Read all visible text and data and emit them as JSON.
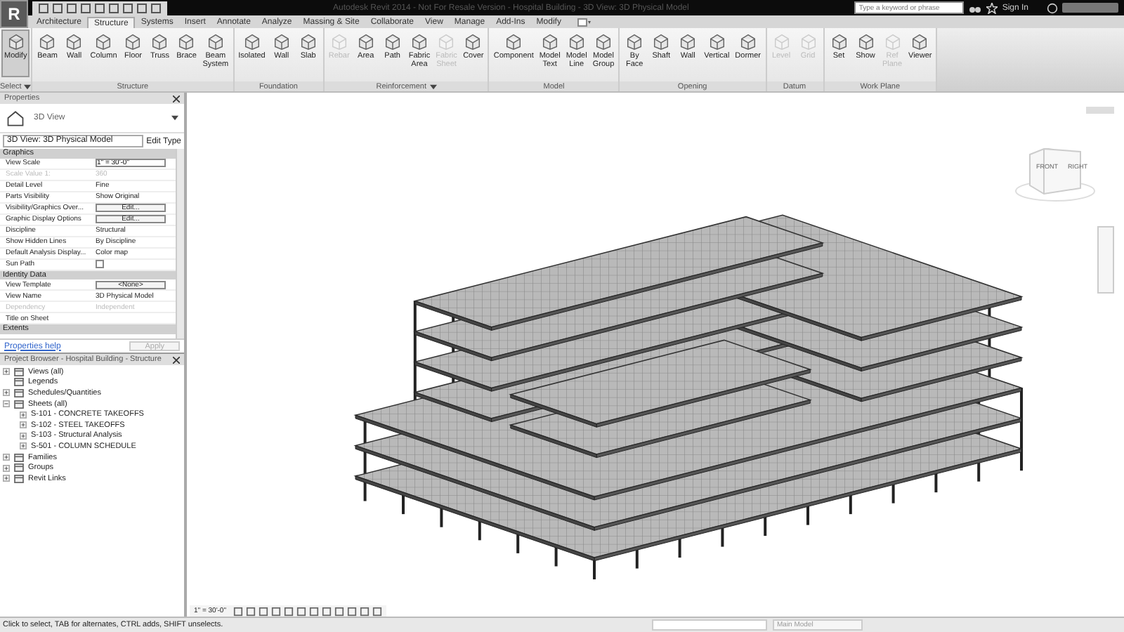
{
  "window": {
    "app_button": "R",
    "title": "Autodesk Revit 2014 - Not For Resale Version - Hospital Building - 3D View: 3D Physical Model"
  },
  "search": {
    "placeholder": "Type a keyword or phrase"
  },
  "sign_in": "Sign In",
  "tabs": [
    {
      "label": "Architecture",
      "selected": false
    },
    {
      "label": "Structure",
      "selected": true
    },
    {
      "label": "Systems",
      "selected": false
    },
    {
      "label": "Insert",
      "selected": false
    },
    {
      "label": "Annotate",
      "selected": false
    },
    {
      "label": "Analyze",
      "selected": false
    },
    {
      "label": "Massing & Site",
      "selected": false
    },
    {
      "label": "Collaborate",
      "selected": false
    },
    {
      "label": "View",
      "selected": false
    },
    {
      "label": "Manage",
      "selected": false
    },
    {
      "label": "Add-Ins",
      "selected": false
    },
    {
      "label": "Modify",
      "selected": false
    }
  ],
  "ribbon": {
    "panels": [
      {
        "title": "Select",
        "dropdown": true,
        "tools": [
          {
            "label": "Modify",
            "active": true,
            "disabled": false
          }
        ]
      },
      {
        "title": "Structure",
        "dropdown": false,
        "tools": [
          {
            "label": "Beam",
            "active": false,
            "disabled": false
          },
          {
            "label": "Wall",
            "active": false,
            "disabled": false
          },
          {
            "label": "Column",
            "active": false,
            "disabled": false
          },
          {
            "label": "Floor",
            "active": false,
            "disabled": false
          },
          {
            "label": "Truss",
            "active": false,
            "disabled": false
          },
          {
            "label": "Brace",
            "active": false,
            "disabled": false
          },
          {
            "label": "Beam System",
            "active": false,
            "disabled": false
          }
        ]
      },
      {
        "title": "Foundation",
        "dropdown": false,
        "tools": [
          {
            "label": "Isolated",
            "active": false,
            "disabled": false
          },
          {
            "label": "Wall",
            "active": false,
            "disabled": false
          },
          {
            "label": "Slab",
            "active": false,
            "disabled": false
          }
        ]
      },
      {
        "title": "Reinforcement",
        "dropdown": true,
        "tools": [
          {
            "label": "Rebar",
            "active": false,
            "disabled": true
          },
          {
            "label": "Area",
            "active": false,
            "disabled": false
          },
          {
            "label": "Path",
            "active": false,
            "disabled": false
          },
          {
            "label": "Fabric Area",
            "active": false,
            "disabled": false
          },
          {
            "label": "Fabric Sheet",
            "active": false,
            "disabled": true
          },
          {
            "label": "Cover",
            "active": false,
            "disabled": false
          }
        ]
      },
      {
        "title": "Model",
        "dropdown": false,
        "tools": [
          {
            "label": "Component",
            "active": false,
            "disabled": false
          },
          {
            "label": "Model Text",
            "active": false,
            "disabled": false
          },
          {
            "label": "Model Line",
            "active": false,
            "disabled": false
          },
          {
            "label": "Model Group",
            "active": false,
            "disabled": false
          }
        ]
      },
      {
        "title": "Opening",
        "dropdown": false,
        "tools": [
          {
            "label": "By Face",
            "active": false,
            "disabled": false
          },
          {
            "label": "Shaft",
            "active": false,
            "disabled": false
          },
          {
            "label": "Wall",
            "active": false,
            "disabled": false
          },
          {
            "label": "Vertical",
            "active": false,
            "disabled": false
          },
          {
            "label": "Dormer",
            "active": false,
            "disabled": false
          }
        ]
      },
      {
        "title": "Datum",
        "dropdown": false,
        "tools": [
          {
            "label": "Level",
            "active": false,
            "disabled": true
          },
          {
            "label": "Grid",
            "active": false,
            "disabled": true
          }
        ]
      },
      {
        "title": "Work Plane",
        "dropdown": false,
        "tools": [
          {
            "label": "Set",
            "active": false,
            "disabled": false
          },
          {
            "label": "Show",
            "active": false,
            "disabled": false
          },
          {
            "label": "Ref Plane",
            "active": false,
            "disabled": true
          },
          {
            "label": "Viewer",
            "active": false,
            "disabled": false
          }
        ]
      }
    ]
  },
  "properties": {
    "title": "Properties",
    "type_name": "3D View",
    "selector": "3D View: 3D Physical Model",
    "edit_type": "Edit Type",
    "sections": [
      {
        "title": "Graphics",
        "rows": [
          {
            "name": "View Scale",
            "value": "1\" = 30'-0\"",
            "kind": "input",
            "disabled": false
          },
          {
            "name": "Scale Value  1:",
            "value": "360",
            "kind": "text",
            "disabled": true
          },
          {
            "name": "Detail Level",
            "value": "Fine",
            "kind": "text",
            "disabled": false
          },
          {
            "name": "Parts Visibility",
            "value": "Show Original",
            "kind": "text",
            "disabled": false
          },
          {
            "name": "Visibility/Graphics Over...",
            "value": "Edit...",
            "kind": "button",
            "disabled": false
          },
          {
            "name": "Graphic Display Options",
            "value": "Edit...",
            "kind": "button",
            "disabled": false
          },
          {
            "name": "Discipline",
            "value": "Structural",
            "kind": "text",
            "disabled": false
          },
          {
            "name": "Show Hidden Lines",
            "value": "By Discipline",
            "kind": "text",
            "disabled": false
          },
          {
            "name": "Default Analysis Display...",
            "value": "Color map",
            "kind": "text",
            "disabled": false
          },
          {
            "name": "Sun Path",
            "kind": "checkbox",
            "checked": false,
            "disabled": false
          }
        ]
      },
      {
        "title": "Identity Data",
        "rows": [
          {
            "name": "View Template",
            "value": "<None>",
            "kind": "button",
            "disabled": false
          },
          {
            "name": "View Name",
            "value": "3D Physical Model",
            "kind": "text",
            "disabled": false
          },
          {
            "name": "Dependency",
            "value": "Independent",
            "kind": "text",
            "disabled": true
          },
          {
            "name": "Title on Sheet",
            "kind": "text",
            "disabled": false
          }
        ]
      },
      {
        "title": "Extents"
      }
    ],
    "help_link": "Properties help",
    "apply": "Apply"
  },
  "project_browser": {
    "title": "Project Browser - Hospital Building - Structure",
    "items": [
      {
        "label": "Views (all)",
        "icon": true,
        "toggle": true,
        "expanded": false
      },
      {
        "label": "Legends",
        "icon": true,
        "toggle": false,
        "expanded": false
      },
      {
        "label": "Schedules/Quantities",
        "icon": true,
        "toggle": true,
        "expanded": false
      },
      {
        "label": "Sheets (all)",
        "icon": true,
        "toggle": true,
        "expanded": true,
        "children": [
          {
            "label": "S-101 - CONCRETE TAKEOFFS",
            "icon": false,
            "toggle": true,
            "expanded": false
          },
          {
            "label": "S-102 - STEEL TAKEOFFS",
            "icon": false,
            "toggle": true,
            "expanded": false
          },
          {
            "label": "S-103 - Structural Analysis",
            "icon": false,
            "toggle": true,
            "expanded": false
          },
          {
            "label": "S-501 - COLUMN SCHEDULE",
            "icon": false,
            "toggle": true,
            "expanded": false
          }
        ]
      },
      {
        "label": "Families",
        "icon": true,
        "toggle": true,
        "expanded": false
      },
      {
        "label": "Groups",
        "icon": true,
        "toggle": true,
        "expanded": false
      },
      {
        "label": "Revit Links",
        "icon": true,
        "toggle": true,
        "expanded": false
      }
    ]
  },
  "viewport": {
    "view_cube": [
      "FRONT",
      "RIGHT"
    ],
    "view_scale": "1\" = 30'-0\""
  },
  "status_bar": {
    "message": "Click to select, TAB for alternates, CTRL adds, SHIFT unselects.",
    "model": "Main Model"
  }
}
